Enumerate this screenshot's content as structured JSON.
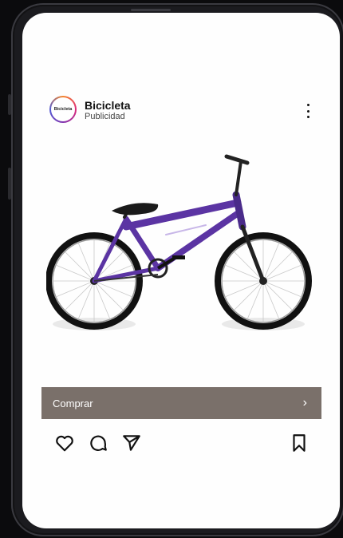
{
  "post": {
    "account_name": "Bicicleta",
    "account_sub": "Publicidad",
    "avatar_text": "Bicicleta",
    "more_icon": "more-vertical-icon",
    "image_alt": "purple BMX bicycle"
  },
  "cta": {
    "label": "Comprar",
    "chevron": "›",
    "color": "#7a706a"
  },
  "actions": {
    "like_icon": "heart-icon",
    "comment_icon": "comment-icon",
    "share_icon": "send-icon",
    "save_icon": "bookmark-icon"
  },
  "colors": {
    "bike_frame": "#5b34a3",
    "screen_bg": "#fefefe"
  }
}
